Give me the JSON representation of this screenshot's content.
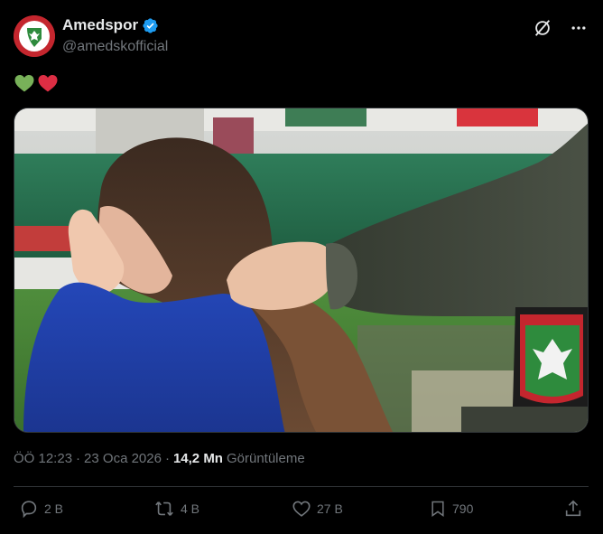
{
  "author": {
    "name": "Amedspor",
    "handle": "@amedskofficial",
    "verified_icon": "verified-badge-icon",
    "avatar_icon": "amedspor-crest-icon"
  },
  "tweet": {
    "text_emoji": [
      "💚",
      "❤️"
    ]
  },
  "top_actions": {
    "grok_icon": "grok-icon",
    "more_icon": "more-dots-icon"
  },
  "meta": {
    "time": "ÖÖ 12:23",
    "separator1": "·",
    "date": "23 Oca 2026",
    "separator2": "·",
    "views_count": "14,2 Mn",
    "views_label": "Görüntüleme"
  },
  "actions": {
    "reply": {
      "count": "2 B",
      "icon": "reply-icon"
    },
    "repost": {
      "count": "4 B",
      "icon": "repost-icon"
    },
    "like": {
      "count": "27 B",
      "icon": "like-icon"
    },
    "bookmark": {
      "count": "790",
      "icon": "bookmark-icon"
    },
    "share": {
      "icon": "share-icon"
    }
  },
  "colors": {
    "background": "#000000",
    "text_primary": "#e7e9ea",
    "text_secondary": "#71767b",
    "verified": "#1d9bf0",
    "brand_red": "#c4262e",
    "brand_green": "#2e8b3d"
  }
}
